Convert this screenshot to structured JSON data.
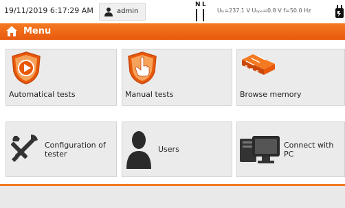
{
  "status": {
    "datetime": "19/11/2019 6:17:29 AM",
    "user": "admin",
    "n_label": "N",
    "l_label": "L",
    "measurement": "Uₗₙ=237.1 V Uₙₚₑ=0.8 V f=50.0 Hz"
  },
  "menu": {
    "title": "Menu"
  },
  "tiles": [
    {
      "label": "Automatical tests"
    },
    {
      "label": "Manual tests"
    },
    {
      "label": "Browse memory"
    },
    {
      "label": "Configuration of tester"
    },
    {
      "label": "Users"
    },
    {
      "label": "Connect with PC"
    }
  ],
  "colors": {
    "accent": "#f47a22",
    "tile_bg": "#ebebeb"
  },
  "icons": [
    "user-icon",
    "plug-icon",
    "home-icon",
    "play-shield-icon",
    "hand-shield-icon",
    "memory-blocks-icon",
    "tools-icon",
    "user-silhouette-icon",
    "computer-icon"
  ]
}
